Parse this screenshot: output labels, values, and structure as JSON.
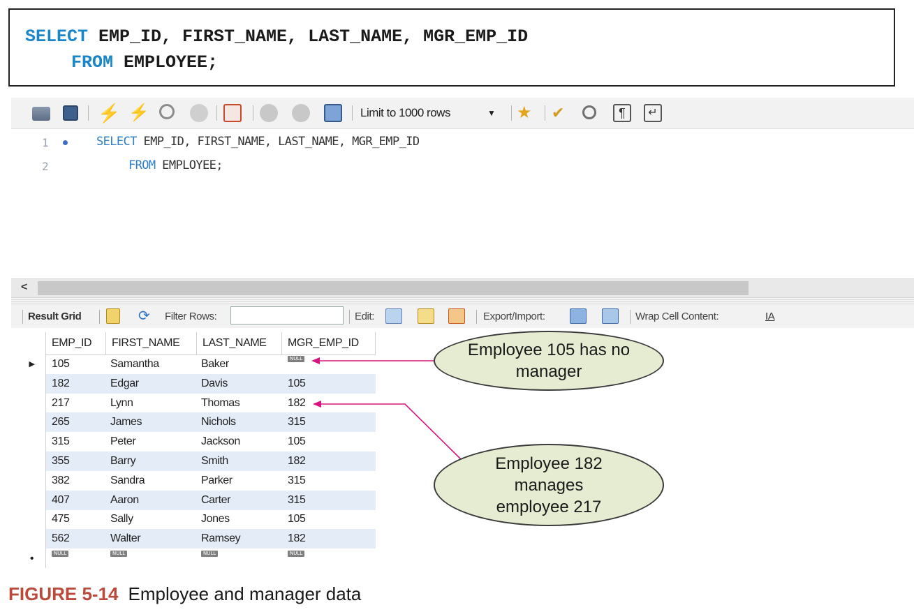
{
  "sql_box": {
    "line1_kw": "SELECT",
    "line1_rest": " EMP_ID, FIRST_NAME, LAST_NAME, MGR_EMP_ID",
    "line2_kw": "FROM",
    "line2_rest": " EMPLOYEE;"
  },
  "toolbar": {
    "limit_label": "Limit to 1000 rows",
    "icons": [
      "open-folder-icon",
      "save-icon",
      "execute-icon",
      "execute-current-icon",
      "explain-icon",
      "stop-icon",
      "error-toggle-icon",
      "commit-icon",
      "rollback-icon",
      "autocommit-icon",
      "bookmark-icon",
      "beautify-icon",
      "find-icon",
      "invisibles-icon",
      "wrap-icon"
    ]
  },
  "editor": {
    "lines": [
      {
        "num": "1",
        "kw": "SELECT",
        "rest": " EMP_ID, FIRST_NAME, LAST_NAME, MGR_EMP_ID"
      },
      {
        "num": "2",
        "kw": "FROM",
        "rest": " EMPLOYEE;"
      }
    ]
  },
  "resultbar": {
    "result_grid": "Result Grid",
    "filter_rows": "Filter Rows:",
    "edit": "Edit:",
    "export_import": "Export/Import:",
    "wrap_cell": "Wrap Cell Content:"
  },
  "grid": {
    "columns": [
      "EMP_ID",
      "FIRST_NAME",
      "LAST_NAME",
      "MGR_EMP_ID"
    ],
    "rows": [
      [
        "105",
        "Samantha",
        "Baker",
        "NULL"
      ],
      [
        "182",
        "Edgar",
        "Davis",
        "105"
      ],
      [
        "217",
        "Lynn",
        "Thomas",
        "182"
      ],
      [
        "265",
        "James",
        "Nichols",
        "315"
      ],
      [
        "315",
        "Peter",
        "Jackson",
        "105"
      ],
      [
        "355",
        "Barry",
        "Smith",
        "182"
      ],
      [
        "382",
        "Sandra",
        "Parker",
        "315"
      ],
      [
        "407",
        "Aaron",
        "Carter",
        "315"
      ],
      [
        "475",
        "Sally",
        "Jones",
        "105"
      ],
      [
        "562",
        "Walter",
        "Ramsey",
        "182"
      ]
    ],
    "null_label": "NULL"
  },
  "callouts": {
    "c1": "Employee 105 has no manager",
    "c2": "Employee 182 manages employee 217",
    "arrow_color": "#d6137e",
    "fill_color": "#e5ecd2"
  },
  "caption": {
    "figure": "FIGURE 5-14",
    "text": "Employee and manager data"
  },
  "colors": {
    "keyword": "#1a86c8",
    "figure_label": "#b94a3c",
    "row_alt": "#e4ecf7"
  }
}
